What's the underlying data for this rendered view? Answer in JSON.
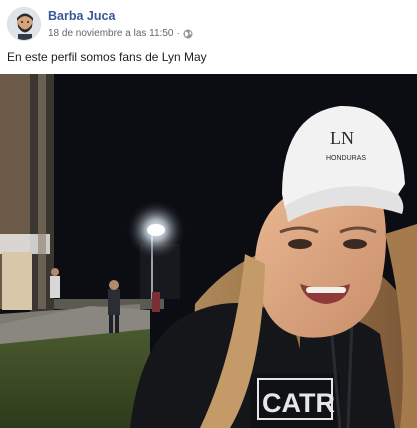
{
  "post": {
    "author": "Barba Juca",
    "timestamp": "18 de noviembre a las 11:50",
    "separator": "·",
    "privacy_icon": "globe-icon",
    "text": "En este perfil somos fans de Lyn May"
  },
  "photo": {
    "cap_text_top": "LN",
    "cap_text_bottom": "HONDURAS",
    "shirt_text": "CATR"
  },
  "colors": {
    "author_link": "#385898",
    "meta_text": "#616770",
    "body_text": "#1c1e21"
  }
}
